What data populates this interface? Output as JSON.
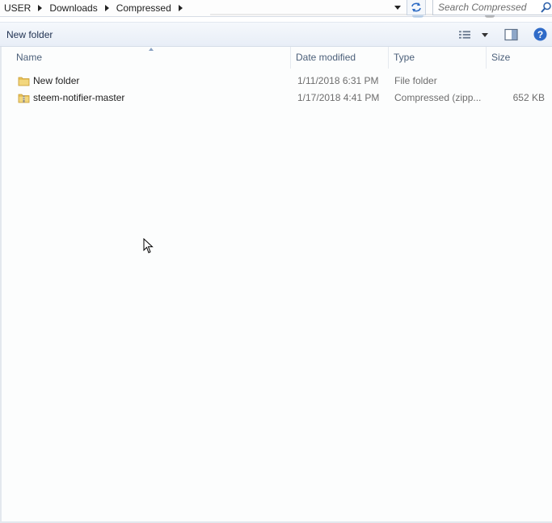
{
  "address_bar": {
    "crumbs": [
      "USER",
      "Downloads",
      "Compressed"
    ]
  },
  "search": {
    "placeholder": "Search Compressed"
  },
  "toolbar": {
    "new_folder_label": "New folder"
  },
  "columns": {
    "name": "Name",
    "date": "Date modified",
    "type": "Type",
    "size": "Size"
  },
  "files": [
    {
      "name": "New folder",
      "date": "1/11/2018 6:31 PM",
      "type": "File folder",
      "size": "",
      "icon": "folder-icon"
    },
    {
      "name": "steem-notifier-master",
      "date": "1/17/2018 4:41 PM",
      "type": "Compressed (zipp...",
      "size": "652 KB",
      "icon": "zip-folder-icon"
    }
  ],
  "colors": {
    "folder": "#e8c25a",
    "accent": "#1e3050",
    "header_text": "#4c607a"
  }
}
